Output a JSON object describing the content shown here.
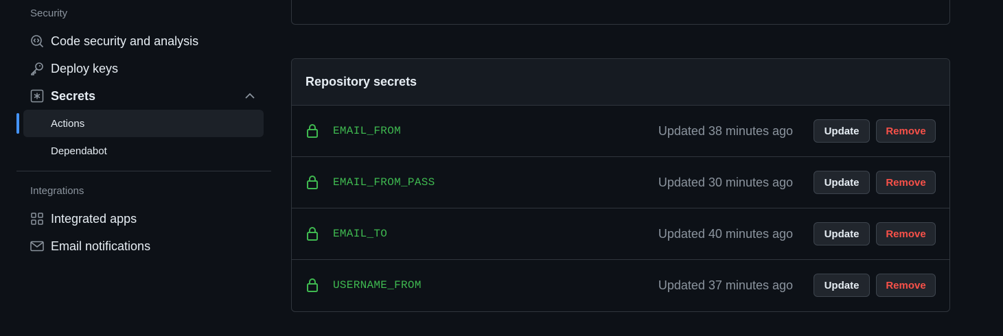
{
  "sidebar": {
    "security_heading": "Security",
    "items": [
      {
        "label": "Code security and analysis",
        "icon": "codescan-icon"
      },
      {
        "label": "Deploy keys",
        "icon": "key-icon"
      },
      {
        "label": "Secrets",
        "icon": "asterisk-icon"
      }
    ],
    "secrets_subitems": [
      {
        "label": "Actions",
        "active": true
      },
      {
        "label": "Dependabot",
        "active": false
      }
    ],
    "integrations_heading": "Integrations",
    "integration_items": [
      {
        "label": "Integrated apps",
        "icon": "apps-icon"
      },
      {
        "label": "Email notifications",
        "icon": "mail-icon"
      }
    ]
  },
  "secrets": {
    "title": "Repository secrets",
    "rows": [
      {
        "name": "EMAIL_FROM",
        "updated": "Updated 38 minutes ago"
      },
      {
        "name": "EMAIL_FROM_PASS",
        "updated": "Updated 30 minutes ago"
      },
      {
        "name": "EMAIL_TO",
        "updated": "Updated 40 minutes ago"
      },
      {
        "name": "USERNAME_FROM",
        "updated": "Updated 37 minutes ago"
      }
    ],
    "update_label": "Update",
    "remove_label": "Remove"
  },
  "colors": {
    "background": "#0d1117",
    "secret_name": "#3fb950",
    "remove_text": "#f85149",
    "active_indicator": "#4493f8"
  }
}
